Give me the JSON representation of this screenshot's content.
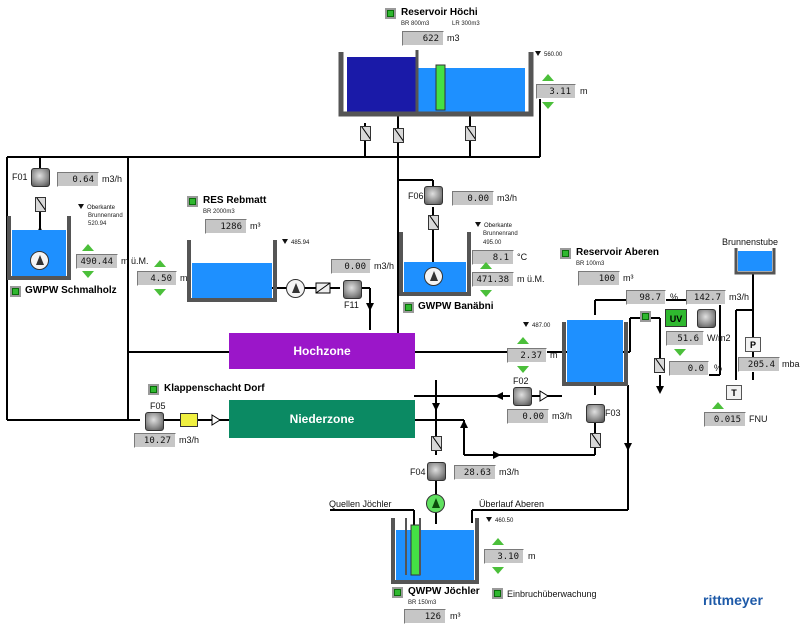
{
  "colors": {
    "water": "#1e90ff",
    "tank_dark": "#1a1aa8",
    "pipe": "#000000",
    "hochzone": "#9b16c9",
    "niederzone": "#0b8a63",
    "accent": "#2fb82f"
  },
  "reservoir_hoechi": {
    "title": "Reservoir Höchi",
    "br": "BR 800m3",
    "lr": "LR 300m3",
    "volume": "622",
    "volume_unit": "m3",
    "level_mark": "560.00",
    "level": "3.11",
    "level_unit": "m"
  },
  "gwpw_schmalholz": {
    "title": "GWPW Schmalholz",
    "meter": "F01",
    "flow": "0.64",
    "flow_unit": "m3/h",
    "note1": "Oberkante",
    "note2": "Brunnenrand",
    "mark": "520.94",
    "level": "490.44",
    "level_unit": "m ü.M."
  },
  "res_rebmatt": {
    "title": "RES Rebmatt",
    "br": "BR 2000m3",
    "volume": "1286",
    "volume_unit": "m³",
    "level_mark": "485.94",
    "level": "4.50",
    "level_unit": "m",
    "meter": "F11",
    "flow": "0.00",
    "flow_unit": "m3/h"
  },
  "gwpw_banaebni": {
    "title": "GWPW Banäbni",
    "meter": "F06",
    "flow": "0.00",
    "flow_unit": "m3/h",
    "note1": "Oberkante",
    "note2": "Brunnenrand",
    "mark": "495.00",
    "temp": "8.1",
    "temp_unit": "°C",
    "level": "471.38",
    "level_unit": "m ü.M."
  },
  "reservoir_aberen": {
    "title": "Reservoir Aberen",
    "br": "BR 100m3",
    "volume": "100",
    "volume_unit": "m³",
    "level_mark": "487.00",
    "level": "2.37",
    "level_unit": "m",
    "meter_in": "F02",
    "flow_in": "0.00",
    "flow_in_unit": "m3/h",
    "meter_out": "F03"
  },
  "uv": {
    "label": "UV",
    "percent1": "98.7",
    "percent1_unit": "%",
    "flow": "142.7",
    "flow_unit": "m3/h",
    "irradiance": "51.6",
    "irradiance_unit": "W/m2",
    "percent2": "0.0",
    "percent2_unit": "%"
  },
  "brunnenstube": {
    "label": "Brunnenstube",
    "p_label": "P",
    "pressure": "205.4",
    "pressure_unit": "mbar",
    "t_label": "T",
    "turbidity": "0.015",
    "turbidity_unit": "FNU"
  },
  "zones": {
    "hoch": "Hochzone",
    "nieder": "Niederzone"
  },
  "klappenschacht": {
    "title": "Klappenschacht Dorf",
    "meter": "F05",
    "flow": "10.27",
    "flow_unit": "m3/h"
  },
  "qwpw_joechler": {
    "title": "QWPW Jöchler",
    "br": "BR 150m3",
    "volume": "126",
    "volume_unit": "m³",
    "meter": "F04",
    "flow": "28.63",
    "flow_unit": "m3/h",
    "level_mark": "460.50",
    "level": "3.10",
    "level_unit": "m",
    "quellen": "Quellen Jöchler",
    "ueberlauf": "Überlauf Aberen",
    "einbruch": "Einbruchüberwachung"
  },
  "brand": "rittmeyer"
}
